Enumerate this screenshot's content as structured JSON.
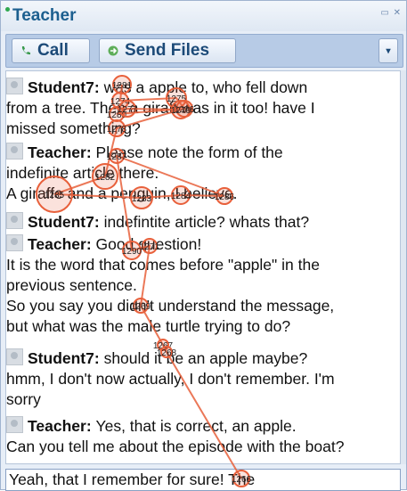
{
  "window": {
    "title": "Teacher"
  },
  "toolbar": {
    "call_label": "Call",
    "send_files_label": "Send Files",
    "more_label": "▾"
  },
  "messages": [
    {
      "sender": "Student7:",
      "lines": [
        "was a apple to, who fell down",
        "from a tree. Then a giraff was in it too! have I",
        "missed something?"
      ]
    },
    {
      "sender": "Teacher:",
      "lines": [
        "Please note the form of the",
        "indefinite article there.",
        "A giraffe and a penguin, I believe."
      ]
    },
    {
      "sender": "Student7:",
      "lines": [
        "indefintite article? whats that?"
      ]
    },
    {
      "sender": "Teacher:",
      "lines": [
        "Good question!",
        "It is the word that comes before \"apple\" in the",
        "previous sentence.",
        "So you say you didn't understand the message,",
        "but what was the male turtle trying to do?"
      ]
    },
    {
      "sender": "Student7:",
      "lines": [
        "should it be an apple maybe?",
        "hmm, I don't now actually, I don't remember. I'm",
        "sorry"
      ]
    },
    {
      "sender": "Teacher:",
      "lines": [
        "Yes, that is correct, an apple.",
        "Can you tell me about the episode with the boat?"
      ]
    }
  ],
  "input": {
    "value": "Yeah, that I remember for sure! The"
  },
  "fixation_labels": [
    "1281",
    "1274",
    "1275",
    "1276",
    "1280",
    "1277",
    "1279",
    "1278",
    "1282",
    "1285",
    "1283",
    "1284",
    "1286",
    "1287",
    "1290",
    "1271",
    "1269",
    "1267",
    "1268",
    "1266"
  ],
  "colors": {
    "title": "#1c5f8f",
    "toolbar": "#b7cbe6",
    "gaze": "#e8603b"
  }
}
